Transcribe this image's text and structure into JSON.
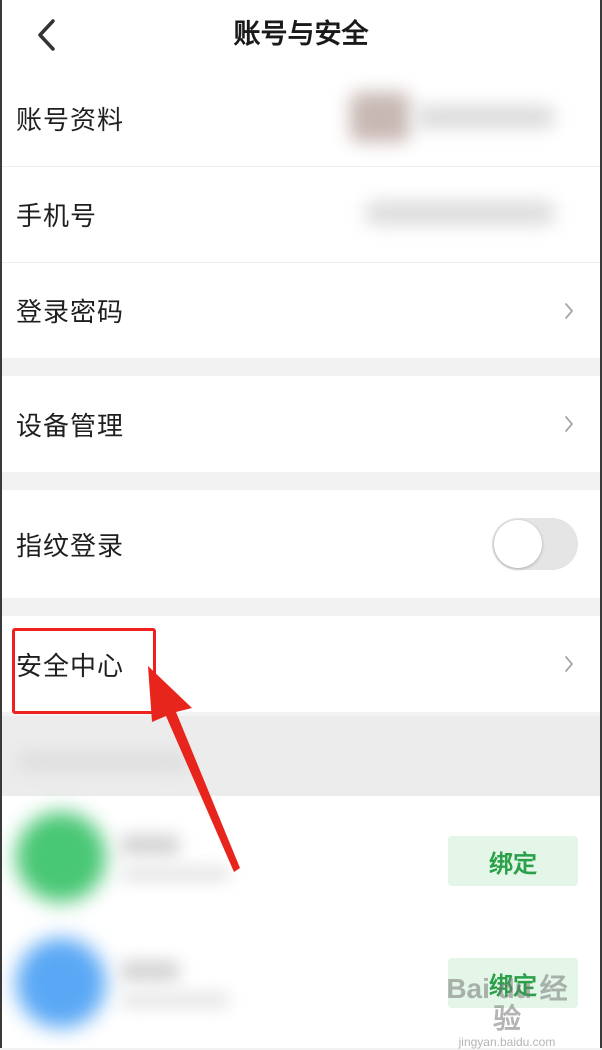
{
  "header": {
    "title": "账号与安全",
    "back_icon": "chevron-left-icon"
  },
  "groups": [
    {
      "items": [
        {
          "label": "账号资料",
          "value": "blurred"
        },
        {
          "label": "手机号",
          "value": "blurred"
        },
        {
          "label": "登录密码",
          "icon": "chevron-right-icon"
        }
      ]
    },
    {
      "items": [
        {
          "label": "设备管理",
          "icon": "chevron-right-icon"
        }
      ]
    },
    {
      "items": [
        {
          "label": "指纹登录",
          "toggle": false
        }
      ]
    },
    {
      "items": [
        {
          "label": "安全中心",
          "icon": "chevron-right-icon",
          "highlighted": true
        }
      ]
    }
  ],
  "third_party": {
    "bind_label_1": "绑定",
    "bind_label_2": "绑定"
  },
  "colors": {
    "accent_green": "#2aa149",
    "bind_bg": "#e3f6e7",
    "highlight_red": "#ee2020",
    "page_bg": "#f2f2f2"
  },
  "watermark": {
    "brand": "Bai du 经验",
    "url": "jingyan.baidu.com"
  }
}
